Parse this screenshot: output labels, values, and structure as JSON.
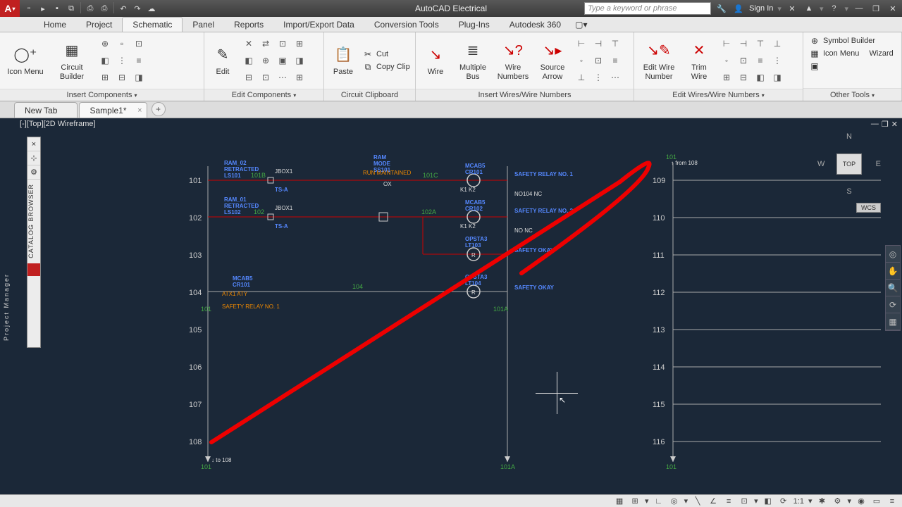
{
  "app": {
    "title": "AutoCAD Electrical"
  },
  "titlebar": {
    "search_placeholder": "Type a keyword or phrase",
    "signin": "Sign In"
  },
  "qat_icons": [
    "new",
    "open",
    "save",
    "saveall",
    "plot",
    "plot2",
    "undo",
    "redo",
    "cloud"
  ],
  "ribbon_tabs": [
    "Home",
    "Project",
    "Schematic",
    "Panel",
    "Reports",
    "Import/Export Data",
    "Conversion Tools",
    "Plug-Ins",
    "Autodesk 360"
  ],
  "ribbon_active": 2,
  "panels": {
    "insert_components": {
      "title": "Insert Components",
      "icon_menu": "Icon Menu",
      "circuit_builder": "Circuit Builder"
    },
    "edit_components": {
      "title": "Edit Components",
      "edit": "Edit"
    },
    "clipboard": {
      "title": "Circuit Clipboard",
      "paste": "Paste",
      "cut": "Cut",
      "copy": "Copy Clip"
    },
    "insert_wires": {
      "title": "Insert Wires/Wire Numbers",
      "wire": "Wire",
      "multiple_bus": "Multiple\nBus",
      "wire_numbers": "Wire\nNumbers",
      "source_arrow": "Source\nArrow"
    },
    "edit_wires": {
      "title": "Edit Wires/Wire Numbers",
      "edit_wire_number": "Edit Wire\nNumber",
      "trim_wire": "Trim\nWire"
    },
    "other": {
      "title": "Other Tools",
      "symbol_builder": "Symbol Builder",
      "icon_menu": "Icon Menu",
      "wizard": "Wizard"
    }
  },
  "doctabs": {
    "new_tab": "New Tab",
    "active": "Sample1*"
  },
  "view": {
    "label": "[-][Top][2D Wireframe]",
    "cube": "TOP",
    "wcs": "WCS"
  },
  "side_palettes": {
    "project": "Project Manager",
    "catalog": "CATALOG BROWSER"
  },
  "rungs_left": [
    "101",
    "102",
    "103",
    "104",
    "105",
    "106",
    "107",
    "108"
  ],
  "rungs_right": [
    "109",
    "110",
    "111",
    "112",
    "113",
    "114",
    "115",
    "116"
  ],
  "wire_labels": {
    "w101b": "101B",
    "w101c": "101C",
    "w102": "102",
    "w102a": "102A",
    "w104": "104",
    "w101a": "101A",
    "w101": "101",
    "w101r": "101",
    "w101ar": "101A",
    "w108": "108",
    "from108": "from 108",
    "to108": "to 108"
  },
  "components": {
    "ls101": {
      "l1": "RAM_02",
      "l2": "RETRACTED",
      "l3": "LS101"
    },
    "ls102": {
      "l1": "RAM_01",
      "l2": "RETRACTED",
      "l3": "LS102"
    },
    "jbox1": "JBOX1",
    "jbox2": "JBOX1",
    "ts_a": "TS-A",
    "ss101": {
      "l1": "RAM",
      "l2": "MODE",
      "l3": "SS101",
      "mode": "RUN   MAINTAINED",
      "ox": "OX"
    },
    "cr101": {
      "l1": "MCAB5",
      "l2": "CR101",
      "k": "K1   K2"
    },
    "cr102": {
      "l1": "MCAB5",
      "l2": "CR102",
      "k": "K1   K2"
    },
    "safety1": "SAFETY\nRELAY NO. 1",
    "safety2": "SAFETY\nRELAY NO. 2",
    "nc104": "NO104\nNC",
    "nc2": "NO\nNC",
    "lt103": {
      "l1": "OPSTA3",
      "l2": "LT103",
      "r": "R"
    },
    "lt104": {
      "l1": "OPSTA3",
      "l2": "LT104",
      "r": "R"
    },
    "safety_okay": "SAFETY\nOKAY",
    "cr101b": {
      "l1": "MCAB5",
      "l2": "CR101"
    },
    "atx": "ATX1   ATY",
    "safety_relay": "SAFETY\nRELAY NO. 1"
  },
  "status": {
    "scale": "1:1"
  }
}
